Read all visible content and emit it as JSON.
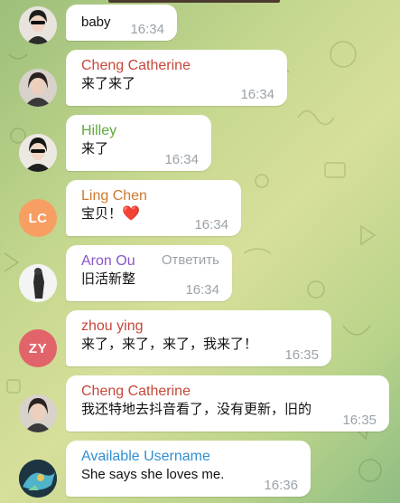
{
  "colors": {
    "name_red": "#c6473a",
    "name_green": "#5fa83b",
    "name_orange": "#d0782d",
    "name_purple": "#8a55c8",
    "name_blue": "#2f8fd1",
    "avatar_orange": "#f79f63",
    "avatar_red": "#e2646b",
    "timestamp": "#9aa3a9"
  },
  "messages": [
    {
      "sender": "",
      "text": "baby",
      "time": "16:34",
      "avatar": "photo-woman-sunglasses"
    },
    {
      "sender": "Cheng Catherine",
      "text": "来了来了",
      "time": "16:34",
      "avatar": "photo-woman"
    },
    {
      "sender": "Hilley",
      "text": "来了",
      "time": "16:34",
      "avatar": "photo-woman-sunglasses"
    },
    {
      "sender": "Ling Chen",
      "text": "宝贝！",
      "emoji": "❤️",
      "time": "16:34",
      "avatar_initials": "LC"
    },
    {
      "sender": "Aron Ou",
      "reply_label": "Ответить",
      "text": "旧活新整",
      "time": "16:34",
      "avatar": "photo-figure"
    },
    {
      "sender": "zhou ying",
      "text": "来了，来了，来了，我来了！",
      "time": "16:35",
      "avatar_initials": "ZY"
    },
    {
      "sender": "Cheng Catherine",
      "text": "我还特地去抖音看了，没有更新，旧的",
      "time": "16:35",
      "avatar": "photo-woman"
    },
    {
      "sender": "Available Username",
      "text": "She says she loves me.",
      "time": "16:36",
      "avatar": "photo-game-character"
    }
  ]
}
